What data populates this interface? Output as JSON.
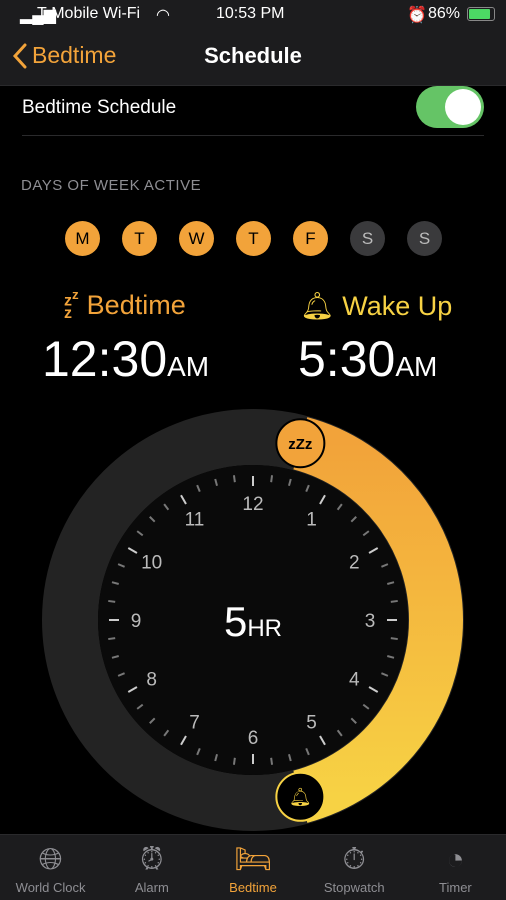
{
  "status": {
    "carrier": "T-Mobile Wi-Fi",
    "time": "10:53 PM",
    "battery": "86%"
  },
  "nav": {
    "back": "Bedtime",
    "title": "Schedule"
  },
  "schedule": {
    "label": "Bedtime Schedule",
    "enabled": true
  },
  "days_label": "DAYS OF WEEK ACTIVE",
  "days": [
    {
      "l": "M",
      "on": true
    },
    {
      "l": "T",
      "on": true
    },
    {
      "l": "W",
      "on": true
    },
    {
      "l": "T",
      "on": true
    },
    {
      "l": "F",
      "on": true
    },
    {
      "l": "S",
      "on": false
    },
    {
      "l": "S",
      "on": false
    }
  ],
  "bedtime": {
    "label": "Bedtime",
    "time": "12:30",
    "ampm": "AM"
  },
  "wake": {
    "label": "Wake Up",
    "time": "5:30",
    "ampm": "AM"
  },
  "duration": {
    "value": "5",
    "unit": "HR"
  },
  "clock_numbers": [
    "12",
    "1",
    "2",
    "3",
    "4",
    "5",
    "6",
    "7",
    "8",
    "9",
    "10",
    "11"
  ],
  "colors": {
    "accent": "#f2a33a",
    "wake": "#f7d244",
    "toggle": "#65c466"
  },
  "tabs": [
    {
      "label": "World Clock",
      "icon": "globe-icon"
    },
    {
      "label": "Alarm",
      "icon": "alarm-clock-icon"
    },
    {
      "label": "Bedtime",
      "icon": "bed-icon",
      "active": true
    },
    {
      "label": "Stopwatch",
      "icon": "stopwatch-icon"
    },
    {
      "label": "Timer",
      "icon": "timer-icon"
    }
  ]
}
